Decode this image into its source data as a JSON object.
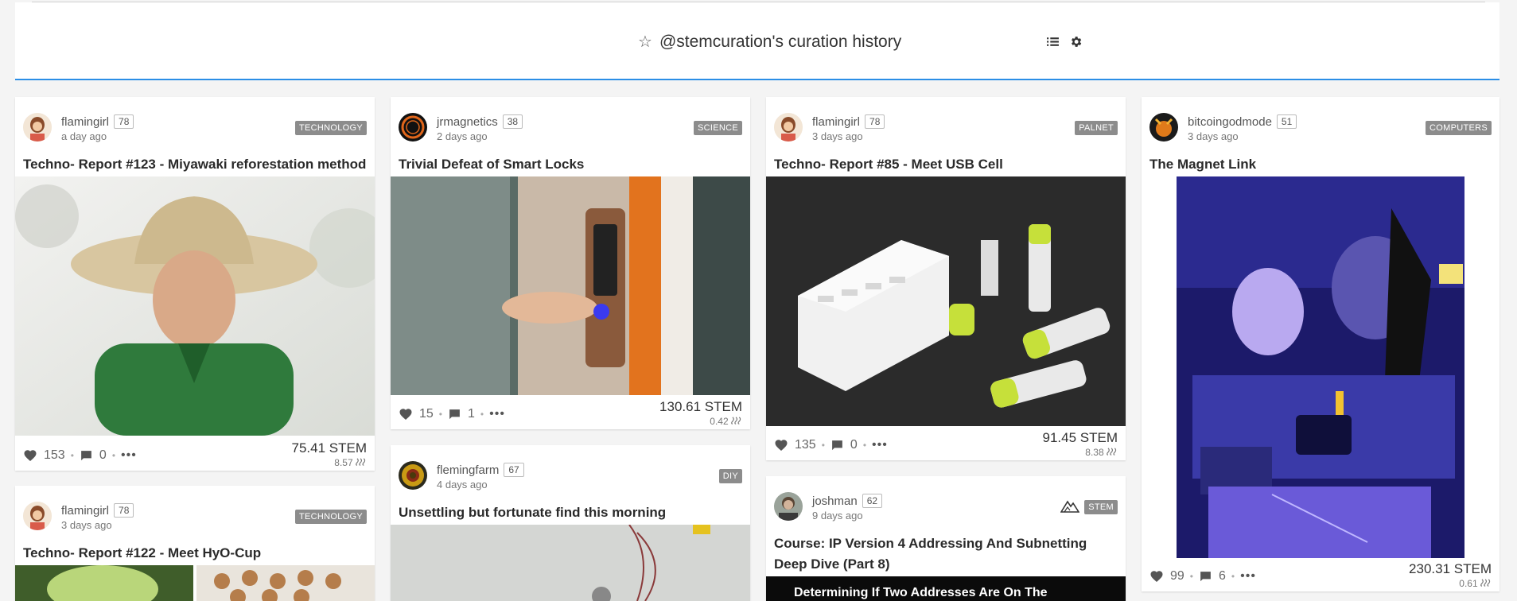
{
  "header": {
    "title": "@stemcuration's curation history",
    "star_icon": "star-outline-icon",
    "list_icon": "list-view-icon",
    "settings_icon": "gear-icon"
  },
  "colors": {
    "accent": "#2b8ee6",
    "tag_bg": "#8c8c8c"
  },
  "posts": [
    {
      "author": "flamingirl",
      "reputation": "78",
      "time": "a day ago",
      "tag": "TECHNOLOGY",
      "title": "Techno- Report #123 - Miyawaki reforestation method",
      "votes": "153",
      "comments": "0",
      "payout": "75.41 STEM",
      "payout_secondary": "8.57"
    },
    {
      "author": "flamingirl",
      "reputation": "78",
      "time": "3 days ago",
      "tag": "TECHNOLOGY",
      "title": "Techno- Report #122 - Meet HyO-Cup"
    },
    {
      "author": "jrmagnetics",
      "reputation": "38",
      "time": "2 days ago",
      "tag": "SCIENCE",
      "title": "Trivial Defeat of Smart Locks",
      "votes": "15",
      "comments": "1",
      "payout": "130.61 STEM",
      "payout_secondary": "0.42"
    },
    {
      "author": "flemingfarm",
      "reputation": "67",
      "time": "4 days ago",
      "tag": "DIY",
      "title": "Unsettling but fortunate find this morning"
    },
    {
      "author": "flamingirl",
      "reputation": "78",
      "time": "3 days ago",
      "tag": "PALNET",
      "title": "Techno- Report #85 - Meet USB Cell",
      "votes": "135",
      "comments": "0",
      "payout": "91.45 STEM",
      "payout_secondary": "8.38"
    },
    {
      "author": "joshman",
      "reputation": "62",
      "time": "9 days ago",
      "tag": "STEM",
      "title": "Course: IP Version 4 Addressing And Subnetting Deep Dive (Part 8)",
      "image_text": "Determining If Two Addresses Are On The"
    },
    {
      "author": "bitcoingodmode",
      "reputation": "51",
      "time": "3 days ago",
      "tag": "COMPUTERS",
      "title": "The Magnet Link",
      "votes": "99",
      "comments": "6",
      "payout": "230.31 STEM",
      "payout_secondary": "0.61"
    }
  ]
}
